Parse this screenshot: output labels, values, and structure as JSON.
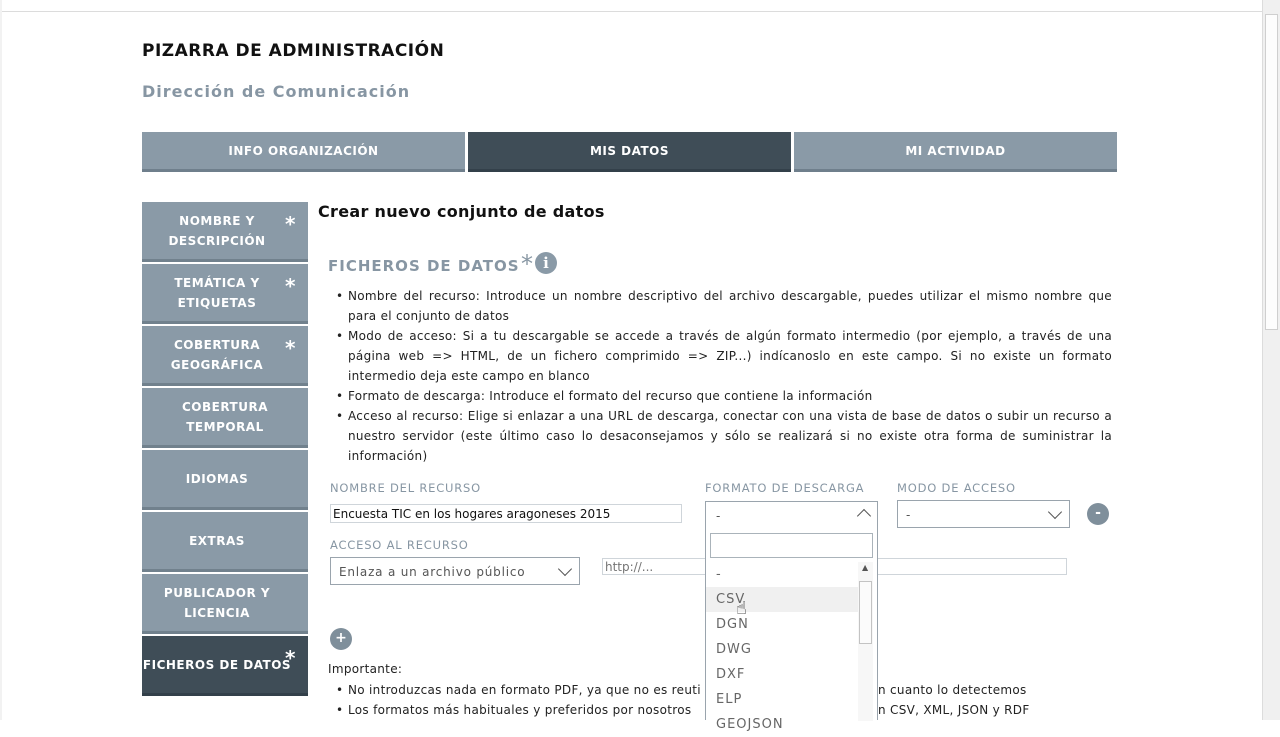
{
  "header": {
    "title": "PIZARRA DE ADMINISTRACIÓN",
    "subtitle": "Dirección de Comunicación"
  },
  "tabs": [
    {
      "label": "INFO ORGANIZACIÓN",
      "active": false
    },
    {
      "label": "MIS DATOS",
      "active": true
    },
    {
      "label": "MI ACTIVIDAD",
      "active": false
    }
  ],
  "sidebar": {
    "items": [
      {
        "label": "NOMBRE Y DESCRIPCIÓN",
        "required": "*"
      },
      {
        "label": "TEMÁTICA Y ETIQUETAS",
        "required": "*"
      },
      {
        "label": "COBERTURA GEOGRÁFICA",
        "required": "*"
      },
      {
        "label": "COBERTURA TEMPORAL",
        "required": ""
      },
      {
        "label": "IDIOMAS",
        "required": ""
      },
      {
        "label": "EXTRAS",
        "required": ""
      },
      {
        "label": "PUBLICADOR Y LICENCIA",
        "required": ""
      },
      {
        "label": "FICHEROS DE DATOS",
        "required": "*",
        "active": true
      }
    ]
  },
  "main": {
    "heading": "Crear nuevo conjunto de datos",
    "section_title": "FICHEROS DE DATOS",
    "section_required": "*",
    "info_icon": "i",
    "bullets": [
      "Nombre del recurso: Introduce un nombre descriptivo del archivo descargable, puedes utilizar el mismo nombre que para el conjunto de datos",
      "Modo de acceso: Si a tu descargable se accede a través de algún formato intermedio (por ejemplo, a través de una página web => HTML, de un fichero comprimido => ZIP...) indícanoslo en este campo. Si no existe un formato intermedio deja este campo en blanco",
      "Formato de descarga: Introduce el formato del recurso que contiene la información",
      "Acceso al recurso: Elige si enlazar a una URL de descarga, conectar con una vista de base de datos o subir un recurso a nuestro servidor (este último caso lo desaconsejamos y sólo se realizará si no existe otra forma de suministrar la información)"
    ]
  },
  "form": {
    "nombre_label": "NOMBRE DEL RECURSO",
    "nombre_value": "Encuesta TIC en los hogares aragoneses 2015",
    "formato_label": "FORMATO DE DESCARGA",
    "formato_value": "-",
    "modo_label": "MODO DE ACCESO",
    "modo_value": "-",
    "acceso_label": "ACCESO AL RECURSO",
    "acceso_value": "Enlaza a un archivo público",
    "url_placeholder": "http://...",
    "remove_label": "-",
    "add_label": "+"
  },
  "dropdown": {
    "search_value": "",
    "options": [
      "-",
      "CSV",
      "DGN",
      "DWG",
      "DXF",
      "ELP",
      "GEOJSON"
    ],
    "highlighted": "CSV"
  },
  "important": {
    "title": "Importante:",
    "bullets": [
      "No introduzcas nada en formato PDF, ya que no es reuti",
      "Los formatos más habituales y preferidos por nosotros"
    ],
    "bullets_tail": [
      "n cuanto lo detectemos",
      "n CSV, XML, JSON y RDF"
    ]
  }
}
